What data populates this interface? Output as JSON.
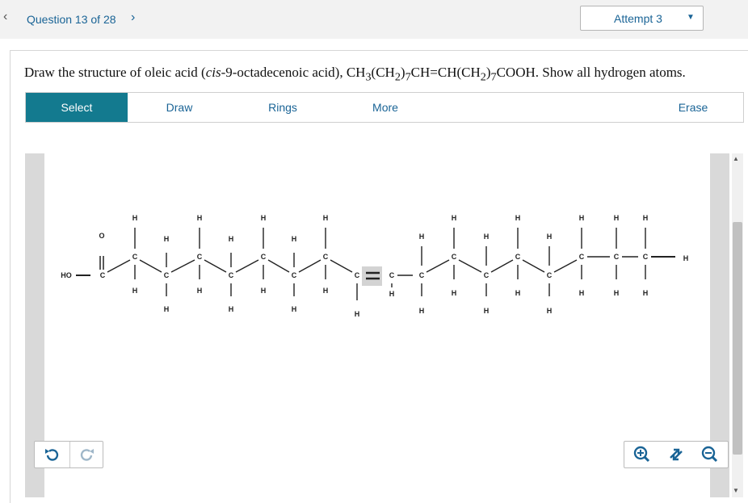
{
  "header": {
    "prev_icon": "chevron-left-icon",
    "question_counter": "Question 13 of 28",
    "next_icon": "chevron-right-icon",
    "attempt_label": "Attempt 3",
    "attempt_caret": "caret-down-icon"
  },
  "question": {
    "pre": "Draw the structure of oleic acid (",
    "italic": "cis",
    "post": "-9-octadecenoic acid), CH",
    "formula_rest": "(CH",
    "formula_rest2": ")",
    "formula_mid": "CH=CH(CH",
    "formula_mid2": ")",
    "formula_end": "COOH. Show all hydrogen atoms.",
    "sub_3": "3",
    "sub_2": "2",
    "sub_7": "7"
  },
  "toolbar": {
    "select": "Select",
    "draw": "Draw",
    "rings": "Rings",
    "more": "More",
    "erase": "Erase"
  },
  "controls": {
    "undo_icon": "undo-icon",
    "redo_icon": "redo-icon",
    "zoom_in_icon": "zoom-in-icon",
    "zoom_reset_icon": "zoom-reset-icon",
    "zoom_out_icon": "zoom-out-icon"
  },
  "molecule": {
    "atom_C": "C",
    "atom_H": "H",
    "atom_O": "O",
    "group_HO": "HO"
  }
}
